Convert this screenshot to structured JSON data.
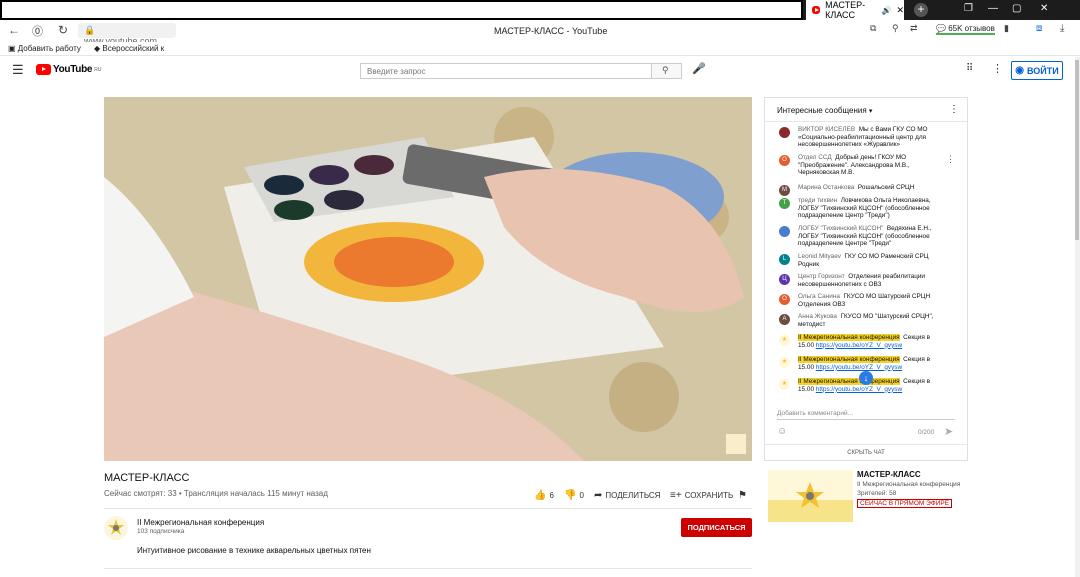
{
  "browser": {
    "tab_title": "МАСТЕР-КЛАСС",
    "url": "www.youtube.com",
    "page_title": "МАСТЕР-КЛАСС - YouTube",
    "reviews": "65K отзывов",
    "bookmarks": [
      "Добавить работу",
      "Всероссийский к"
    ]
  },
  "header": {
    "logo": "YouTube",
    "logo_region": "RU",
    "search_placeholder": "Введите запрос",
    "signin_label": "ВОЙТИ"
  },
  "video": {
    "title": "МАСТЕР-КЛАСС",
    "stats": "Сейчас смотрят: 33 • Трансляция началась 115 минут назад",
    "likes": "6",
    "dislikes": "0",
    "share_label": "ПОДЕЛИТЬСЯ",
    "save_label": "СОХРАНИТЬ"
  },
  "channel": {
    "name": "II Межрегиональная конференция",
    "subscribers": "103 подписчика",
    "subscribe_label": "ПОДПИСАТЬСЯ",
    "description": "Интуитивное рисование в технике акварельных цветных пятен"
  },
  "chat": {
    "header": "Интересные сообщения",
    "messages": [
      {
        "author": "ВИКТОР КИСЕЛЕВ",
        "text": "Мы с Вами ГКУ СО МО «Социально-реабилитационный центр для несовершеннолетних «Журавлик»",
        "initial": "",
        "color": "#8b2a2a"
      },
      {
        "author": "Отдел ССД",
        "text": "Добрый день! ГКОУ МО \"Преображение\". Александрова М.В., Черняковская М.В.",
        "initial": "О",
        "color": "#e65c2f"
      },
      {
        "author": "Марина Останкова",
        "text": "Рошальский СРЦН",
        "initial": "М",
        "color": "#6d4c41"
      },
      {
        "author": "треди тихвин",
        "text": "Ловчикова Ольга Николаевна, ЛОГБУ \"Тихвинский КЦСОН\" (обособленное подразделение Центр \"Треди\")",
        "initial": "Т",
        "color": "#43a047"
      },
      {
        "author": "ЛОГБУ \"Тихвинский КЦСОН\"",
        "text": "Ведяхина Е.Н., ЛОГБУ \"Тихвинский КЦСОН\" (обособленное подразделение Центре \"Треди\"",
        "initial": "",
        "color": "#4a7bd0"
      },
      {
        "author": "Leonid Mityaev",
        "text": "ГКУ СО МО Раменский СРЦ Родник",
        "initial": "L",
        "color": "#00838f"
      },
      {
        "author": "Центр Горизонт",
        "text": "Отделения реабилитации несовершеннолетних с ОВЗ",
        "initial": "Ц",
        "color": "#5e35b1"
      },
      {
        "author": "Ольга Санина",
        "text": "ГКУСО МО Шатурский СРЦН Отделения ОВЗ",
        "initial": "О",
        "color": "#e65c2f"
      },
      {
        "author": "Анна Жукова",
        "text": "ГКУСО МО \"Шатурский СРЦН\", методист",
        "initial": "А",
        "color": "#6d4c41"
      }
    ],
    "pinned": [
      {
        "author": "II Межрегиональная конференция",
        "text": "Секция в 15.00",
        "link": "https://youtu.be/oYZ_V_gvysw"
      },
      {
        "author": "II Межрегиональная конференция",
        "text": "Секция в 15.00",
        "link": "https://youtu.be/oYZ_V_gvysw"
      },
      {
        "author": "II Межрегиональная конференция",
        "text": "Секция в 15.00",
        "link": "https://youtu.be/oYZ_V_gvysw"
      }
    ],
    "input_placeholder": "Добавить комментарий...",
    "char_count": "0/200",
    "footer": "СКРЫТЬ ЧАТ"
  },
  "recommendation": {
    "title": "МАСТЕР-КЛАСС",
    "channel": "II Межрегиональная конференция",
    "viewers": "Зрителей: 58",
    "live_badge": "СЕЙЧАС В ПРЯМОМ ЭФИРЕ"
  },
  "colors": {
    "youtube_red": "#ff0000",
    "subscribe_red": "#cc0000",
    "link_blue": "#065fd4",
    "highlight_yellow": "#f5d22a"
  }
}
